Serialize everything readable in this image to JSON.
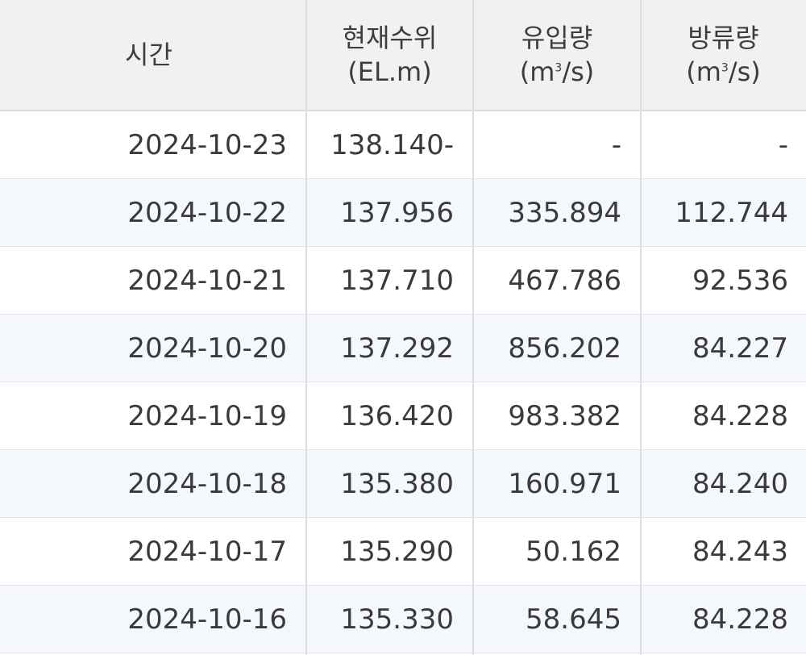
{
  "columns": {
    "time": "시간",
    "level": {
      "label": "현재수위",
      "unit": "(EL.m)"
    },
    "inflow": {
      "label": "유입량",
      "unit_pre": "(m",
      "unit_sup": "3",
      "unit_post": "/s)"
    },
    "outflow": {
      "label": "방류량",
      "unit_pre": "(m",
      "unit_sup": "3",
      "unit_post": "/s)"
    }
  },
  "rows": [
    {
      "date": "2024-10-23",
      "level": "138.140-",
      "inflow": "-",
      "outflow": "-"
    },
    {
      "date": "2024-10-22",
      "level": "137.956",
      "inflow": "335.894",
      "outflow": "112.744"
    },
    {
      "date": "2024-10-21",
      "level": "137.710",
      "inflow": "467.786",
      "outflow": "92.536"
    },
    {
      "date": "2024-10-20",
      "level": "137.292",
      "inflow": "856.202",
      "outflow": "84.227"
    },
    {
      "date": "2024-10-19",
      "level": "136.420",
      "inflow": "983.382",
      "outflow": "84.228"
    },
    {
      "date": "2024-10-18",
      "level": "135.380",
      "inflow": "160.971",
      "outflow": "84.240"
    },
    {
      "date": "2024-10-17",
      "level": "135.290",
      "inflow": "50.162",
      "outflow": "84.243"
    },
    {
      "date": "2024-10-16",
      "level": "135.330",
      "inflow": "58.645",
      "outflow": "84.228"
    }
  ]
}
